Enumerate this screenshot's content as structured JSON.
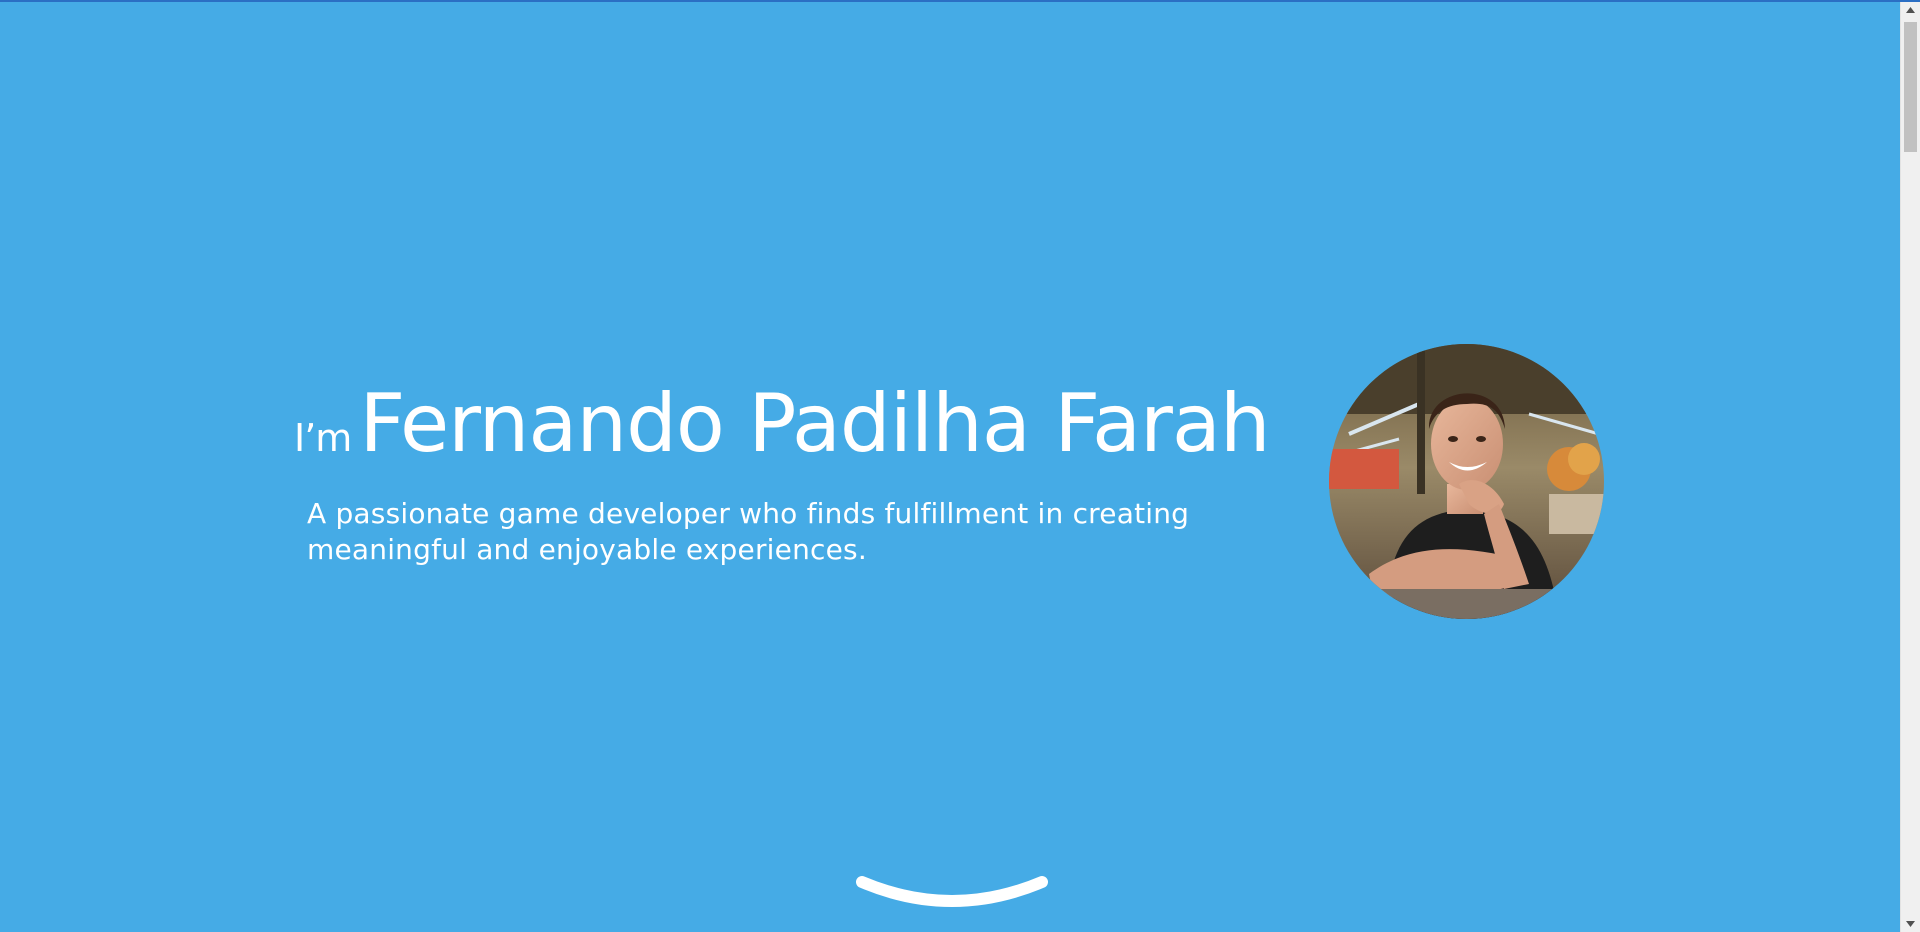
{
  "hero": {
    "prefix": "I’m",
    "name": "Fernando Padilha Farah",
    "tagline_line1": "A passionate game developer who finds fulfillment in creating",
    "tagline_line2": "meaningful and enjoyable experiences."
  },
  "colors": {
    "background": "#45abe6",
    "text": "#ffffff",
    "top_border": "#2b6fc4"
  },
  "icons": {
    "scroll_down": "chevron-down-icon",
    "scroll_up_arrow": "triangle-up-icon",
    "scroll_down_arrow": "triangle-down-icon"
  }
}
